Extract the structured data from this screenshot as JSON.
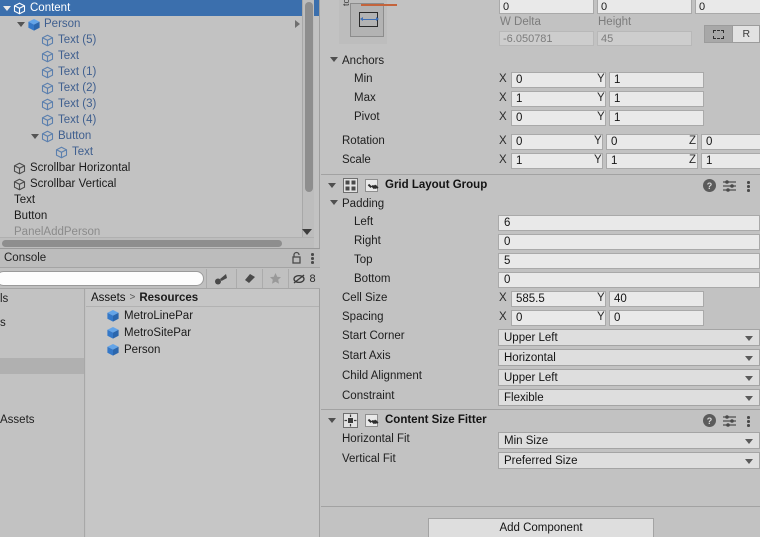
{
  "accent": {
    "selection_blue": "#3b6fad",
    "panel_bg": "#c2c2c2",
    "field_bg": "#e9e9e9",
    "anchor_orange": "#c4643c"
  },
  "hierarchy": {
    "rows": [
      {
        "label": "Content",
        "depth": 0,
        "twisty": "down",
        "icon": "gameobject-cube-icon",
        "state": "selected"
      },
      {
        "label": "Person",
        "depth": 1,
        "twisty": "down",
        "icon": "prefab-cube-icon",
        "state": "prefab",
        "chevron": true
      },
      {
        "label": "Text (5)",
        "depth": 2,
        "twisty": "none",
        "icon": "gameobject-cube-icon",
        "state": "prefab"
      },
      {
        "label": "Text",
        "depth": 2,
        "twisty": "none",
        "icon": "gameobject-cube-icon",
        "state": "prefab"
      },
      {
        "label": "Text (1)",
        "depth": 2,
        "twisty": "none",
        "icon": "gameobject-cube-icon",
        "state": "prefab"
      },
      {
        "label": "Text (2)",
        "depth": 2,
        "twisty": "none",
        "icon": "gameobject-cube-icon",
        "state": "prefab"
      },
      {
        "label": "Text (3)",
        "depth": 2,
        "twisty": "none",
        "icon": "gameobject-cube-icon",
        "state": "prefab"
      },
      {
        "label": "Text (4)",
        "depth": 2,
        "twisty": "none",
        "icon": "gameobject-cube-icon",
        "state": "prefab"
      },
      {
        "label": "Button",
        "depth": 2,
        "twisty": "down",
        "icon": "gameobject-cube-icon",
        "state": "prefab"
      },
      {
        "label": "Text",
        "depth": 3,
        "twisty": "none",
        "icon": "gameobject-cube-icon",
        "state": "prefab"
      },
      {
        "label": "Scrollbar Horizontal",
        "depth": 0,
        "twisty": "none",
        "icon": "gameobject-cube-icon",
        "state": "normal"
      },
      {
        "label": "Scrollbar Vertical",
        "depth": 0,
        "twisty": "none",
        "icon": "gameobject-cube-icon",
        "state": "normal"
      },
      {
        "label": "Text",
        "depth": 0,
        "twisty": "none",
        "icon": "none",
        "state": "normal"
      },
      {
        "label": "Button",
        "depth": 0,
        "twisty": "none",
        "icon": "none",
        "state": "normal"
      },
      {
        "label": "PanelAddPerson",
        "depth": 0,
        "twisty": "none",
        "icon": "none",
        "state": "disabled"
      }
    ]
  },
  "console": {
    "tab_label": "Console",
    "lock_icon": "lock-icon",
    "menu_icon": "kebab-menu-icon",
    "search_placeholder": "",
    "search_value": "",
    "tools": [
      {
        "name": "clear-on-play-icon",
        "label": ""
      },
      {
        "name": "error-pause-icon",
        "label": ""
      },
      {
        "name": "favorite-star-icon",
        "label": ""
      },
      {
        "name": "error-toggle-icon",
        "label": "8"
      }
    ]
  },
  "project": {
    "tree_rows": [
      {
        "label": "ls",
        "sel": false
      },
      {
        "label": "s",
        "sel": false
      },
      {
        "label": "",
        "sel": false
      },
      {
        "label": "",
        "sel": true
      },
      {
        "label": "",
        "sel": false
      },
      {
        "label": "Assets",
        "sel": false
      }
    ],
    "breadcrumb": {
      "root": "Assets",
      "separator": ">",
      "current": "Resources"
    },
    "assets": [
      {
        "label": "MetroLinePar",
        "icon": "prefab-cube-icon"
      },
      {
        "label": "MetroSitePar",
        "icon": "prefab-cube-icon"
      },
      {
        "label": "Person",
        "icon": "prefab-cube-icon"
      }
    ]
  },
  "inspector": {
    "rect_transform": {
      "anchor_widget_label": "top",
      "row_top_values": [
        "0",
        "0",
        "0"
      ],
      "delta_labels": [
        "W Delta",
        "Height"
      ],
      "delta_values": [
        "-6.050781",
        "45"
      ],
      "blueprint_button": "blueprint-mode-icon",
      "raw_button": "R",
      "anchors_label": "Anchors",
      "rows": [
        {
          "label": "Min",
          "axes": [
            {
              "axis": "X",
              "value": "0"
            },
            {
              "axis": "Y",
              "value": "1"
            }
          ]
        },
        {
          "label": "Max",
          "axes": [
            {
              "axis": "X",
              "value": "1"
            },
            {
              "axis": "Y",
              "value": "1"
            }
          ]
        },
        {
          "label": "Pivot",
          "axes": [
            {
              "axis": "X",
              "value": "0"
            },
            {
              "axis": "Y",
              "value": "1"
            }
          ]
        }
      ],
      "transform_rows": [
        {
          "label": "Rotation",
          "axes": [
            {
              "axis": "X",
              "value": "0"
            },
            {
              "axis": "Y",
              "value": "0"
            },
            {
              "axis": "Z",
              "value": "0"
            }
          ]
        },
        {
          "label": "Scale",
          "axes": [
            {
              "axis": "X",
              "value": "1"
            },
            {
              "axis": "Y",
              "value": "1"
            },
            {
              "axis": "Z",
              "value": "1"
            }
          ]
        }
      ]
    },
    "components": [
      {
        "title": "Grid Layout Group",
        "icon": "grid-layout-icon",
        "enabled": true,
        "help_icon": "help-icon",
        "preset_icon": "preset-icon",
        "menu_icon": "kebab-menu-icon",
        "padding_label": "Padding",
        "padding": [
          {
            "label": "Left",
            "value": "6"
          },
          {
            "label": "Right",
            "value": "0"
          },
          {
            "label": "Top",
            "value": "5"
          },
          {
            "label": "Bottom",
            "value": "0"
          }
        ],
        "vector_rows": [
          {
            "label": "Cell Size",
            "axes": [
              {
                "axis": "X",
                "value": "585.5"
              },
              {
                "axis": "Y",
                "value": "40"
              }
            ]
          },
          {
            "label": "Spacing",
            "axes": [
              {
                "axis": "X",
                "value": "0"
              },
              {
                "axis": "Y",
                "value": "0"
              }
            ]
          }
        ],
        "dropdowns": [
          {
            "label": "Start Corner",
            "value": "Upper Left"
          },
          {
            "label": "Start Axis",
            "value": "Horizontal"
          },
          {
            "label": "Child Alignment",
            "value": "Upper Left"
          },
          {
            "label": "Constraint",
            "value": "Flexible"
          }
        ]
      },
      {
        "title": "Content Size Fitter",
        "icon": "content-size-fitter-icon",
        "enabled": true,
        "help_icon": "help-icon",
        "preset_icon": "preset-icon",
        "menu_icon": "kebab-menu-icon",
        "dropdowns": [
          {
            "label": "Horizontal Fit",
            "value": "Min Size"
          },
          {
            "label": "Vertical Fit",
            "value": "Preferred Size"
          }
        ]
      }
    ],
    "add_component_label": "Add Component"
  }
}
